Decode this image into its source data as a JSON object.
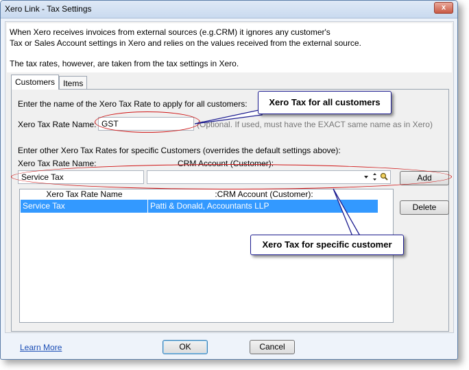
{
  "window": {
    "title": "Xero Link - Tax Settings",
    "close_label": "x"
  },
  "info": {
    "line1": "When Xero receives invoices from external sources (e.g.CRM) it ignores any customer's",
    "line2": "Tax or Sales Account settings in Xero and relies on the values received from the external source.",
    "line3": "The tax rates, however, are taken from the tax settings in Xero."
  },
  "tabs": [
    {
      "label": "Customers",
      "active": true
    },
    {
      "label": "Items",
      "active": false
    }
  ],
  "customers": {
    "intro": "Enter the name of the Xero Tax Rate to apply for all customers:",
    "rate_label": "Xero Tax Rate Name:",
    "rate_value": "GST",
    "rate_hint": "(Optional. If used, must have the EXACT same name as in Xero)",
    "specific_intro": "Enter other Xero Tax Rates for specific Customers (overrides the default settings above):",
    "col_rate_label": "Xero Tax Rate Name:",
    "col_account_label": "CRM Account (Customer):",
    "specific_rate_value": "Service Tax",
    "specific_account_value": "",
    "add_label": "Add",
    "delete_label": "Delete",
    "grid": {
      "headers": [
        "Xero Tax Rate Name",
        ":CRM Account (Customer):"
      ],
      "rows": [
        {
          "rate": "Service Tax",
          "account": "Patti & Donald, Accountants LLP",
          "selected": true
        }
      ]
    }
  },
  "callouts": {
    "all_customers": "Xero Tax for all customers",
    "specific_customer": "Xero Tax for specific customer"
  },
  "footer": {
    "learn_more": "Learn More",
    "ok_label": "OK",
    "cancel_label": "Cancel"
  },
  "icons": {
    "dropdown": "chevron-down-icon",
    "search": "magnifier-icon"
  }
}
